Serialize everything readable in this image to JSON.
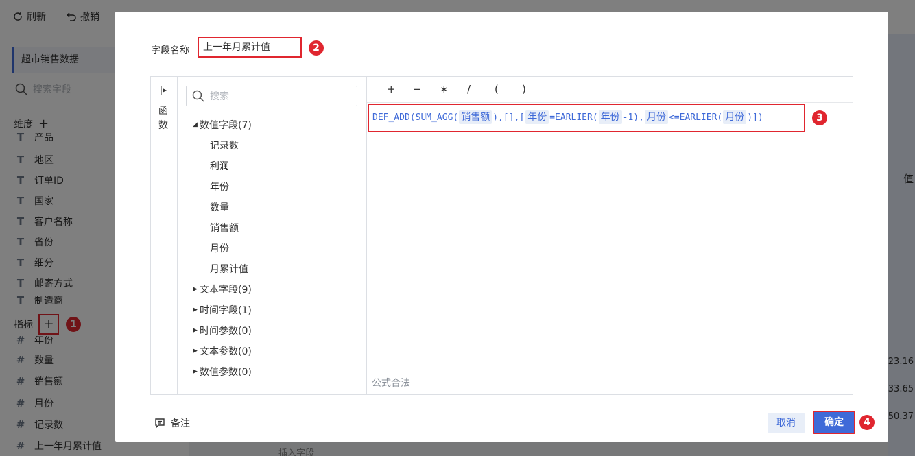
{
  "toolbar": {
    "refresh": "刷新",
    "undo": "撤销"
  },
  "left_panel": {
    "dataset_name": "超市销售数据",
    "search_placeholder": "搜索字段",
    "dimension_title": "维度",
    "dimension_add": "+",
    "dimensions": [
      "产品",
      "地区",
      "订单ID",
      "国家",
      "客户名称",
      "省份",
      "细分",
      "邮寄方式",
      "制造商"
    ],
    "measure_title": "指标",
    "measure_add": "+",
    "measures": [
      "年份",
      "数量",
      "销售额",
      "月份",
      "记录数",
      "上一年月累计值"
    ],
    "insert_field": "插入字段"
  },
  "background_right": {
    "header_text": "值",
    "values": [
      "23.16",
      "33.65",
      "50.37"
    ]
  },
  "dialog": {
    "name_label": "字段名称",
    "name_value": "上一年月累计值",
    "side_tab_label": "函数",
    "tree_search_placeholder": "搜索",
    "tree": {
      "numeric_group": "数值字段(7)",
      "numeric_fields": [
        "记录数",
        "利润",
        "年份",
        "数量",
        "销售额",
        "月份",
        "月累计值"
      ],
      "groups": [
        "文本字段(9)",
        "时间字段(1)",
        "时间参数(0)",
        "文本参数(0)",
        "数值参数(0)"
      ]
    },
    "operators": [
      "+",
      "−",
      "∗",
      "/",
      "(",
      ")"
    ],
    "formula": {
      "p1": "DEF_ADD(SUM_AGG(",
      "t1": "销售额",
      "p2": "),[],[",
      "t2": "年份",
      "p3": "=EARLIER(",
      "t3": "年份",
      "p4": "-1),",
      "t4": "月份",
      "p5": "<=EARLIER(",
      "t5": "月份",
      "p6": ")])"
    },
    "validation": "公式合法",
    "remark": "备注",
    "cancel": "取消",
    "confirm": "确定"
  },
  "badges": [
    "1",
    "2",
    "3",
    "4"
  ]
}
